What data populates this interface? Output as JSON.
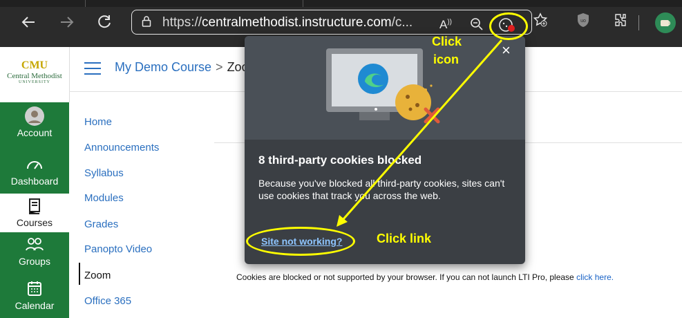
{
  "browser": {
    "url_prefix": "https://",
    "url_host": "centralmethodist.instructure.com",
    "url_suffix": "/c..."
  },
  "brand": {
    "logo_line1": "CMU",
    "logo_line2": "Central Methodist",
    "logo_line3": "UNIVERSITY"
  },
  "global_nav": [
    {
      "label": "Account",
      "icon": "avatar"
    },
    {
      "label": "Dashboard",
      "icon": "dashboard-icon"
    },
    {
      "label": "Courses",
      "icon": "courses-icon"
    },
    {
      "label": "Groups",
      "icon": "groups-icon"
    },
    {
      "label": "Calendar",
      "icon": "calendar-icon"
    }
  ],
  "breadcrumb": {
    "course": "My Demo Course",
    "separator": ">",
    "current": "Zoo"
  },
  "course_nav": [
    {
      "label": "Home"
    },
    {
      "label": "Announcements"
    },
    {
      "label": "Syllabus"
    },
    {
      "label": "Modules"
    },
    {
      "label": "Grades"
    },
    {
      "label": "Panopto Video"
    },
    {
      "label": "Zoom"
    },
    {
      "label": "Office 365"
    }
  ],
  "content": {
    "dots": "...",
    "notice_text": "Cookies are blocked or not supported by your browser. If you can not launch LTI Pro, please",
    "notice_link": "click here."
  },
  "popup": {
    "title": "8 third-party cookies blocked",
    "body": "Because you've blocked all third-party cookies, sites can't use cookies that track you across the web.",
    "link": "Site not working?",
    "close": "×"
  },
  "annotations": {
    "click_icon_line1": "Click",
    "click_icon_line2": "icon",
    "click_link": "Click link"
  },
  "colors": {
    "annotation": "#ffff00",
    "canvas_green": "#1e7a3a",
    "link_blue": "#2a6fbf"
  }
}
